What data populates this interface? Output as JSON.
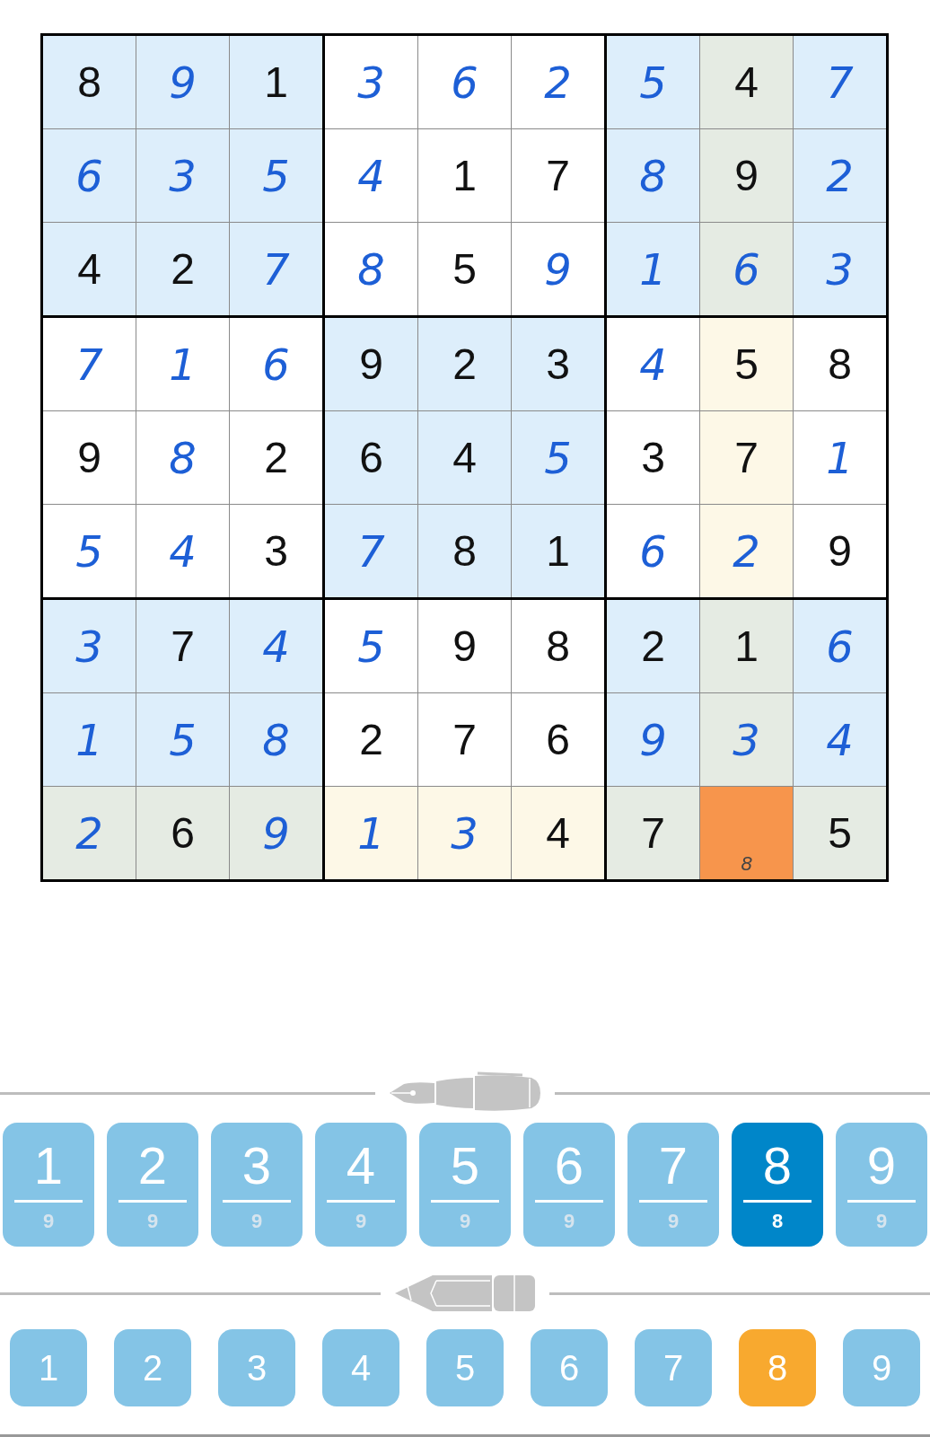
{
  "board": {
    "rows": [
      [
        {
          "value": "8",
          "given": true,
          "highlighted": false,
          "selected": false
        },
        {
          "value": "9",
          "given": false,
          "highlighted": false,
          "selected": false
        },
        {
          "value": "1",
          "given": true,
          "highlighted": false,
          "selected": false
        },
        {
          "value": "3",
          "given": false,
          "highlighted": false,
          "selected": false
        },
        {
          "value": "6",
          "given": false,
          "highlighted": false,
          "selected": false
        },
        {
          "value": "2",
          "given": false,
          "highlighted": false,
          "selected": false
        },
        {
          "value": "5",
          "given": false,
          "highlighted": false,
          "selected": false
        },
        {
          "value": "4",
          "given": true,
          "highlighted": true,
          "selected": false
        },
        {
          "value": "7",
          "given": false,
          "highlighted": false,
          "selected": false
        }
      ],
      [
        {
          "value": "6",
          "given": false,
          "highlighted": false,
          "selected": false
        },
        {
          "value": "3",
          "given": false,
          "highlighted": false,
          "selected": false
        },
        {
          "value": "5",
          "given": false,
          "highlighted": false,
          "selected": false
        },
        {
          "value": "4",
          "given": false,
          "highlighted": false,
          "selected": false
        },
        {
          "value": "1",
          "given": true,
          "highlighted": false,
          "selected": false
        },
        {
          "value": "7",
          "given": true,
          "highlighted": false,
          "selected": false
        },
        {
          "value": "8",
          "given": false,
          "highlighted": false,
          "selected": false
        },
        {
          "value": "9",
          "given": true,
          "highlighted": true,
          "selected": false
        },
        {
          "value": "2",
          "given": false,
          "highlighted": false,
          "selected": false
        }
      ],
      [
        {
          "value": "4",
          "given": true,
          "highlighted": false,
          "selected": false
        },
        {
          "value": "2",
          "given": true,
          "highlighted": false,
          "selected": false
        },
        {
          "value": "7",
          "given": false,
          "highlighted": false,
          "selected": false
        },
        {
          "value": "8",
          "given": false,
          "highlighted": false,
          "selected": false
        },
        {
          "value": "5",
          "given": true,
          "highlighted": false,
          "selected": false
        },
        {
          "value": "9",
          "given": false,
          "highlighted": false,
          "selected": false
        },
        {
          "value": "1",
          "given": false,
          "highlighted": false,
          "selected": false
        },
        {
          "value": "6",
          "given": false,
          "highlighted": true,
          "selected": false
        },
        {
          "value": "3",
          "given": false,
          "highlighted": false,
          "selected": false
        }
      ],
      [
        {
          "value": "7",
          "given": false,
          "highlighted": false,
          "selected": false
        },
        {
          "value": "1",
          "given": false,
          "highlighted": false,
          "selected": false
        },
        {
          "value": "6",
          "given": false,
          "highlighted": false,
          "selected": false
        },
        {
          "value": "9",
          "given": true,
          "highlighted": false,
          "selected": false
        },
        {
          "value": "2",
          "given": true,
          "highlighted": false,
          "selected": false
        },
        {
          "value": "3",
          "given": true,
          "highlighted": false,
          "selected": false
        },
        {
          "value": "4",
          "given": false,
          "highlighted": false,
          "selected": false
        },
        {
          "value": "5",
          "given": true,
          "highlighted": true,
          "selected": false
        },
        {
          "value": "8",
          "given": true,
          "highlighted": false,
          "selected": false
        }
      ],
      [
        {
          "value": "9",
          "given": true,
          "highlighted": false,
          "selected": false
        },
        {
          "value": "8",
          "given": false,
          "highlighted": false,
          "selected": false
        },
        {
          "value": "2",
          "given": true,
          "highlighted": false,
          "selected": false
        },
        {
          "value": "6",
          "given": true,
          "highlighted": false,
          "selected": false
        },
        {
          "value": "4",
          "given": true,
          "highlighted": false,
          "selected": false
        },
        {
          "value": "5",
          "given": false,
          "highlighted": false,
          "selected": false
        },
        {
          "value": "3",
          "given": true,
          "highlighted": false,
          "selected": false
        },
        {
          "value": "7",
          "given": true,
          "highlighted": true,
          "selected": false
        },
        {
          "value": "1",
          "given": false,
          "highlighted": false,
          "selected": false
        }
      ],
      [
        {
          "value": "5",
          "given": false,
          "highlighted": false,
          "selected": false
        },
        {
          "value": "4",
          "given": false,
          "highlighted": false,
          "selected": false
        },
        {
          "value": "3",
          "given": true,
          "highlighted": false,
          "selected": false
        },
        {
          "value": "7",
          "given": false,
          "highlighted": false,
          "selected": false
        },
        {
          "value": "8",
          "given": true,
          "highlighted": false,
          "selected": false
        },
        {
          "value": "1",
          "given": true,
          "highlighted": false,
          "selected": false
        },
        {
          "value": "6",
          "given": false,
          "highlighted": false,
          "selected": false
        },
        {
          "value": "2",
          "given": false,
          "highlighted": true,
          "selected": false
        },
        {
          "value": "9",
          "given": true,
          "highlighted": false,
          "selected": false
        }
      ],
      [
        {
          "value": "3",
          "given": false,
          "highlighted": false,
          "selected": false
        },
        {
          "value": "7",
          "given": true,
          "highlighted": false,
          "selected": false
        },
        {
          "value": "4",
          "given": false,
          "highlighted": false,
          "selected": false
        },
        {
          "value": "5",
          "given": false,
          "highlighted": false,
          "selected": false
        },
        {
          "value": "9",
          "given": true,
          "highlighted": false,
          "selected": false
        },
        {
          "value": "8",
          "given": true,
          "highlighted": false,
          "selected": false
        },
        {
          "value": "2",
          "given": true,
          "highlighted": false,
          "selected": false
        },
        {
          "value": "1",
          "given": true,
          "highlighted": true,
          "selected": false
        },
        {
          "value": "6",
          "given": false,
          "highlighted": false,
          "selected": false
        }
      ],
      [
        {
          "value": "1",
          "given": false,
          "highlighted": false,
          "selected": false
        },
        {
          "value": "5",
          "given": false,
          "highlighted": false,
          "selected": false
        },
        {
          "value": "8",
          "given": false,
          "highlighted": false,
          "selected": false
        },
        {
          "value": "2",
          "given": true,
          "highlighted": false,
          "selected": false
        },
        {
          "value": "7",
          "given": true,
          "highlighted": false,
          "selected": false
        },
        {
          "value": "6",
          "given": true,
          "highlighted": false,
          "selected": false
        },
        {
          "value": "9",
          "given": false,
          "highlighted": false,
          "selected": false
        },
        {
          "value": "3",
          "given": false,
          "highlighted": true,
          "selected": false
        },
        {
          "value": "4",
          "given": false,
          "highlighted": false,
          "selected": false
        }
      ],
      [
        {
          "value": "2",
          "given": false,
          "highlighted": true,
          "selected": false
        },
        {
          "value": "6",
          "given": true,
          "highlighted": true,
          "selected": false
        },
        {
          "value": "9",
          "given": false,
          "highlighted": true,
          "selected": false
        },
        {
          "value": "1",
          "given": false,
          "highlighted": true,
          "selected": false
        },
        {
          "value": "3",
          "given": false,
          "highlighted": true,
          "selected": false
        },
        {
          "value": "4",
          "given": true,
          "highlighted": true,
          "selected": false
        },
        {
          "value": "7",
          "given": true,
          "highlighted": true,
          "selected": false
        },
        {
          "notes": [
            "8"
          ],
          "selected": true
        },
        {
          "value": "5",
          "given": true,
          "highlighted": true,
          "selected": false
        }
      ]
    ]
  },
  "pen_keys": [
    {
      "digit": "1",
      "count": "9",
      "selected": false
    },
    {
      "digit": "2",
      "count": "9",
      "selected": false
    },
    {
      "digit": "3",
      "count": "9",
      "selected": false
    },
    {
      "digit": "4",
      "count": "9",
      "selected": false
    },
    {
      "digit": "5",
      "count": "9",
      "selected": false
    },
    {
      "digit": "6",
      "count": "9",
      "selected": false
    },
    {
      "digit": "7",
      "count": "9",
      "selected": false
    },
    {
      "digit": "8",
      "count": "8",
      "selected": true
    },
    {
      "digit": "9",
      "count": "9",
      "selected": false
    }
  ],
  "pencil_keys": [
    {
      "digit": "1",
      "selected": false
    },
    {
      "digit": "2",
      "selected": false
    },
    {
      "digit": "3",
      "selected": false
    },
    {
      "digit": "4",
      "selected": false
    },
    {
      "digit": "5",
      "selected": false
    },
    {
      "digit": "6",
      "selected": false
    },
    {
      "digit": "7",
      "selected": false
    },
    {
      "digit": "8",
      "selected": true
    },
    {
      "digit": "9",
      "selected": false
    }
  ]
}
